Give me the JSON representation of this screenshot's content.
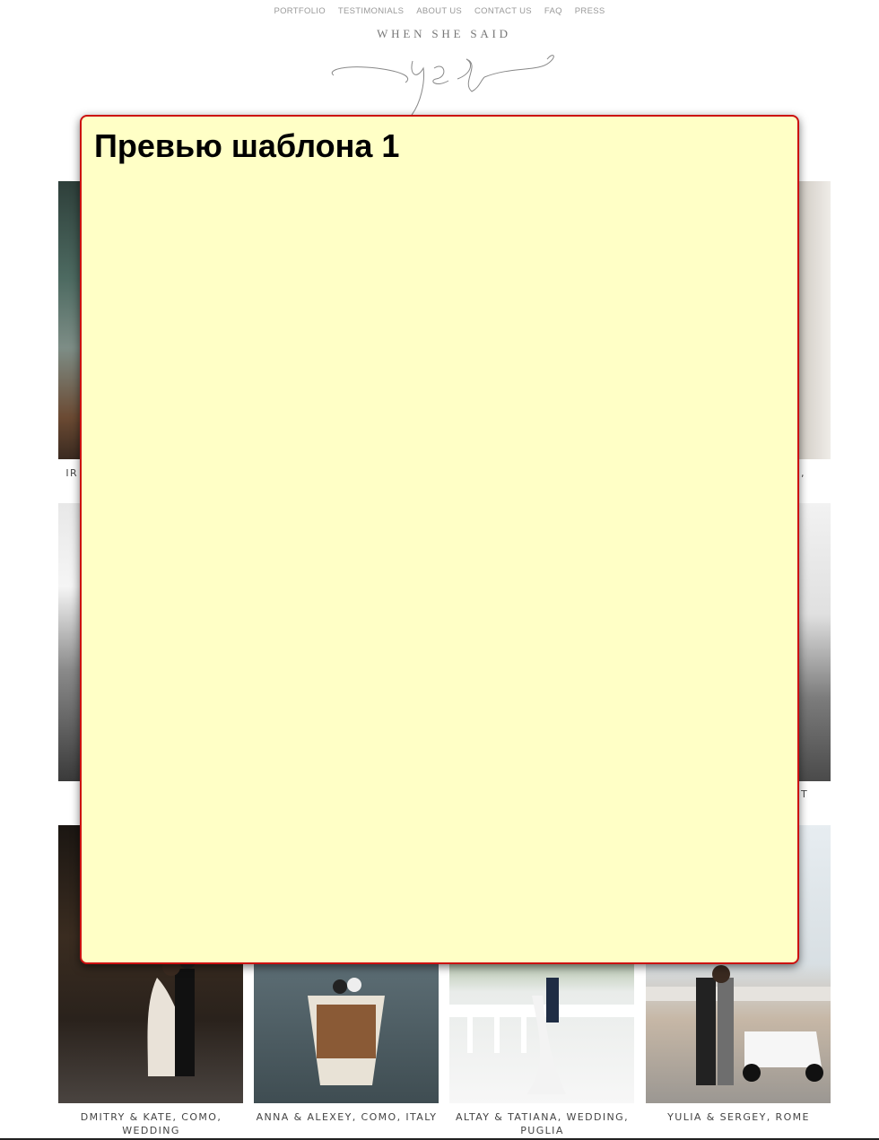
{
  "nav": {
    "items": [
      "PORTFOLIO",
      "TESTIMONIALS",
      "ABOUT US",
      "CONTACT US",
      "FAQ",
      "PRESS"
    ]
  },
  "logo": {
    "line1": "WHEN SHE SAID",
    "script": "yes"
  },
  "gallery": {
    "row1_captions": {
      "left_fragment": "IR",
      "right_fragment": ","
    },
    "row2_captions": {
      "right_fragment": "T"
    },
    "row3_captions": [
      "DMITRY & KATE, COMO, WEDDING",
      "ANNA & ALEXEY, COMO, ITALY",
      "ALTAY & TATIANA, WEDDING, PUGLIA",
      "YULIA & SERGEY, ROME"
    ]
  },
  "modal": {
    "title": "Превью шаблона 1",
    "background": "#ffffc6",
    "border_color": "#cc1111"
  }
}
